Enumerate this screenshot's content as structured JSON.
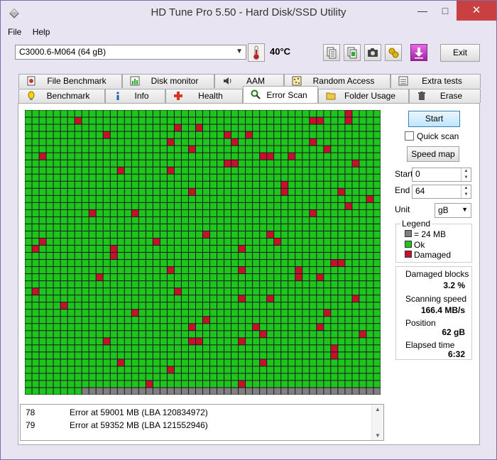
{
  "window": {
    "title": "HD Tune Pro 5.50 - Hard Disk/SSD Utility",
    "minimize_glyph": "—",
    "maximize_glyph": "□",
    "close_glyph": "✕"
  },
  "menu": {
    "file": "File",
    "help": "Help"
  },
  "toolbar": {
    "drive": "C3000.6-M064 (64 gB)",
    "temperature": "40°C",
    "exit_label": "Exit",
    "icons": [
      "copy-text-icon",
      "copy-screenshot-icon",
      "camera-icon",
      "options-icon",
      "download-icon"
    ]
  },
  "tabs": {
    "top": [
      "File Benchmark",
      "Disk monitor",
      "AAM",
      "Random Access",
      "Extra tests"
    ],
    "bottom": [
      "Benchmark",
      "Info",
      "Health",
      "Error Scan",
      "Folder Usage",
      "Erase"
    ],
    "active": "Error Scan"
  },
  "controls": {
    "start_label": "Start",
    "quick_scan_label": "Quick scan",
    "quick_scan_checked": false,
    "speed_map_label": "Speed map",
    "start_field_label": "Start",
    "start_value": "0",
    "end_field_label": "End",
    "end_value": "64",
    "unit_label": "Unit",
    "unit_value": "gB"
  },
  "legend": {
    "title": "Legend",
    "block_size": "= 24 MB",
    "ok": "Ok",
    "damaged": "Damaged",
    "colors": {
      "unscanned": "#808080",
      "ok": "#1fc41f",
      "damaged": "#c8102e"
    }
  },
  "stats": {
    "damaged_blocks_label": "Damaged blocks",
    "damaged_blocks_value": "3.2 %",
    "scanning_speed_label": "Scanning speed",
    "scanning_speed_value": "166.4 MB/s",
    "position_label": "Position",
    "position_value": "62 gB",
    "elapsed_label": "Elapsed time",
    "elapsed_value": "6:32"
  },
  "log": [
    {
      "num": "78",
      "text": "Error at 59001 MB (LBA 120834972)"
    },
    {
      "num": "79",
      "text": "Error at 59352 MB (LBA 121552946)"
    }
  ],
  "scan_map": {
    "columns": 50,
    "rows": 40,
    "unscanned_row": 39,
    "unscanned_from_col": 8,
    "damaged_cells": [
      [
        0,
        45
      ],
      [
        1,
        7
      ],
      [
        1,
        40
      ],
      [
        1,
        41
      ],
      [
        1,
        45
      ],
      [
        2,
        21
      ],
      [
        2,
        24
      ],
      [
        3,
        11
      ],
      [
        3,
        28
      ],
      [
        3,
        31
      ],
      [
        4,
        20
      ],
      [
        4,
        29
      ],
      [
        4,
        40
      ],
      [
        5,
        23
      ],
      [
        5,
        42
      ],
      [
        6,
        2
      ],
      [
        6,
        33
      ],
      [
        6,
        34
      ],
      [
        6,
        37
      ],
      [
        7,
        28
      ],
      [
        7,
        29
      ],
      [
        7,
        46
      ],
      [
        8,
        13
      ],
      [
        8,
        20
      ],
      [
        10,
        36
      ],
      [
        11,
        23
      ],
      [
        11,
        36
      ],
      [
        11,
        44
      ],
      [
        12,
        48
      ],
      [
        13,
        45
      ],
      [
        14,
        15
      ],
      [
        14,
        40
      ],
      [
        17,
        34
      ],
      [
        18,
        2
      ],
      [
        18,
        18
      ],
      [
        18,
        35
      ],
      [
        19,
        1
      ],
      [
        19,
        12
      ],
      [
        19,
        30
      ],
      [
        20,
        12
      ],
      [
        21,
        43
      ],
      [
        21,
        44
      ],
      [
        22,
        20
      ],
      [
        22,
        30
      ],
      [
        22,
        38
      ],
      [
        23,
        38
      ],
      [
        23,
        41
      ],
      [
        25,
        1
      ],
      [
        25,
        21
      ],
      [
        26,
        30
      ],
      [
        26,
        34
      ],
      [
        26,
        46
      ],
      [
        27,
        5
      ],
      [
        28,
        15
      ],
      [
        28,
        42
      ],
      [
        29,
        25
      ],
      [
        30,
        23
      ],
      [
        30,
        32
      ],
      [
        30,
        41
      ],
      [
        31,
        33
      ],
      [
        31,
        47
      ],
      [
        32,
        11
      ],
      [
        32,
        23
      ],
      [
        32,
        24
      ],
      [
        32,
        30
      ],
      [
        33,
        43
      ],
      [
        34,
        43
      ],
      [
        35,
        33
      ],
      [
        36,
        20
      ],
      [
        38,
        17
      ],
      [
        38,
        30
      ],
      [
        14,
        9
      ],
      [
        17,
        25
      ],
      [
        23,
        10
      ],
      [
        35,
        13
      ]
    ]
  }
}
